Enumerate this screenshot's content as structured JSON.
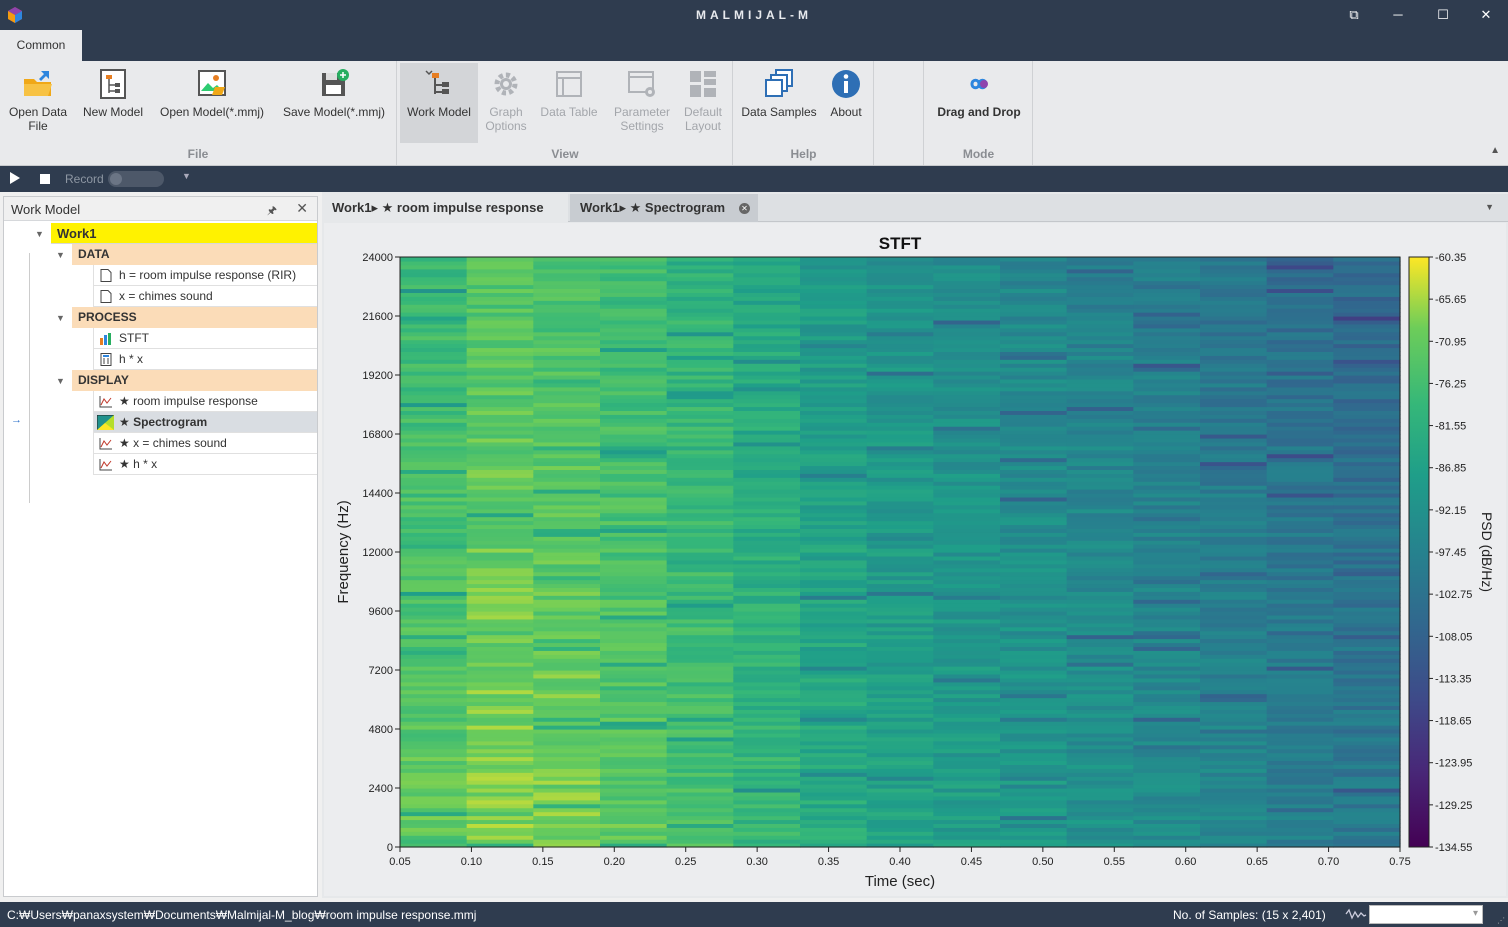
{
  "window": {
    "title": "MALMIJAL-M"
  },
  "ribbon": {
    "tab": "Common",
    "groups": {
      "file": "File",
      "view": "View",
      "help": "Help",
      "mode": "Mode"
    },
    "buttons": {
      "open_data_file_1": "Open Data",
      "open_data_file_2": "File",
      "new_model": "New Model",
      "open_model": "Open Model(*.mmj)",
      "save_model": "Save Model(*.mmj)",
      "work_model": "Work Model",
      "graph_options_1": "Graph",
      "graph_options_2": "Options",
      "data_table": "Data Table",
      "parameter_settings_1": "Parameter",
      "parameter_settings_2": "Settings",
      "default_layout_1": "Default",
      "default_layout_2": "Layout",
      "data_samples": "Data Samples",
      "about": "About",
      "drag_and_drop": "Drag and Drop"
    }
  },
  "toolbar": {
    "record_label": "Record"
  },
  "work_model_panel": {
    "title": "Work Model",
    "root": "Work1",
    "categories": {
      "data": "DATA",
      "process": "PROCESS",
      "display": "DISPLAY"
    },
    "data_items": [
      "h = room impulse response (RIR)",
      "x = chimes sound"
    ],
    "process_items": [
      "STFT",
      "h * x"
    ],
    "display_items": [
      "★ room impulse response",
      "★ Spectrogram",
      "★ x = chimes sound",
      "★ h * x"
    ],
    "selected_item": "★ Spectrogram"
  },
  "document_tabs": [
    {
      "label": "Work1▸ ★ room impulse response",
      "active": false
    },
    {
      "label": "Work1▸ ★ Spectrogram",
      "active": true
    }
  ],
  "status": {
    "path": "C:₩Users₩panaxsystem₩Documents₩Malmijal-M_blog₩room impulse response.mmj",
    "samples": "No. of Samples: (15 x 2,401)"
  },
  "chart_data": {
    "type": "heatmap",
    "title": "STFT",
    "xlabel": "Time (sec)",
    "ylabel": "Frequency (Hz)",
    "colorbar_label": "PSD (dB/Hz)",
    "colormap": "viridis",
    "x": [
      0.05,
      0.1,
      0.15,
      0.2,
      0.25,
      0.3,
      0.35,
      0.4,
      0.45,
      0.5,
      0.55,
      0.6,
      0.65,
      0.7,
      0.75
    ],
    "xlim": [
      0.05,
      0.75
    ],
    "ylim": [
      0,
      24000
    ],
    "x_ticks": [
      "0.05",
      "0.10",
      "0.15",
      "0.20",
      "0.25",
      "0.30",
      "0.35",
      "0.40",
      "0.45",
      "0.50",
      "0.55",
      "0.60",
      "0.65",
      "0.70",
      "0.75"
    ],
    "y_ticks": [
      "0",
      "2400",
      "4800",
      "7200",
      "9600",
      "12000",
      "14400",
      "16800",
      "19200",
      "21600",
      "24000"
    ],
    "colorbar_ticks": [
      "-60.35",
      "-65.65",
      "-70.95",
      "-76.25",
      "-81.55",
      "-86.85",
      "-92.15",
      "-97.45",
      "-102.75",
      "-108.05",
      "-113.35",
      "-118.65",
      "-123.95",
      "-129.25",
      "-134.55"
    ],
    "zlim": [
      -134.55,
      -60.35
    ],
    "frequency_bins": 2401,
    "time_frames": 15,
    "approx_column_mean_psd": [
      -72,
      -68,
      -69,
      -72,
      -75,
      -79,
      -83,
      -86,
      -88,
      -90,
      -92,
      -94,
      -96,
      -98,
      -100
    ]
  }
}
